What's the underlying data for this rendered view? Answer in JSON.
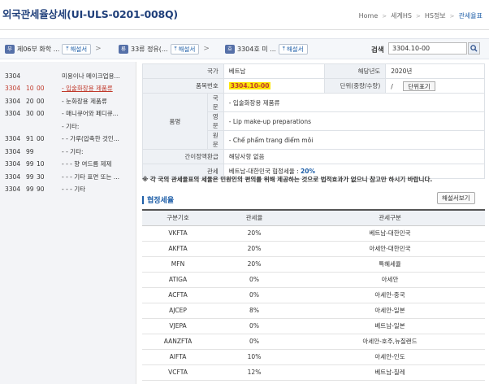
{
  "header": {
    "title": "외국관세율상세(UI-ULS-0201-008Q)",
    "breadcrumbs": [
      "Home",
      "세계HS",
      "HS정보",
      "관세율표"
    ]
  },
  "nav": {
    "segments": [
      {
        "tag": "부",
        "text": "제06부 화학 ...",
        "button": "해설서"
      },
      {
        "tag": "류",
        "text": "33류 정유(...",
        "button": "해설서"
      },
      {
        "tag": "호",
        "text": "3304호 미 ...",
        "button": "해설서"
      }
    ],
    "search_label": "검색",
    "search_value": "3304.10-00"
  },
  "tree": [
    {
      "c1": "3304",
      "c2": "",
      "c3": "",
      "desc": "미용이나 메이크업용...",
      "active": false
    },
    {
      "c1": "3304",
      "c2": "10",
      "c3": "00",
      "desc": "- 입술화장용 제품류",
      "active": true
    },
    {
      "c1": "3304",
      "c2": "20",
      "c3": "00",
      "desc": "- 눈화장용 제품류",
      "active": false
    },
    {
      "c1": "3304",
      "c2": "30",
      "c3": "00",
      "desc": "- 매니큐어와 페디큐...",
      "active": false
    },
    {
      "c1": "",
      "c2": "",
      "c3": "",
      "desc": "- 기타:",
      "active": false
    },
    {
      "c1": "3304",
      "c2": "91",
      "c3": "00",
      "desc": "- - 가루(압축한 것인...",
      "active": false
    },
    {
      "c1": "3304",
      "c2": "99",
      "c3": "",
      "desc": "- - 기타:",
      "active": false
    },
    {
      "c1": "3304",
      "c2": "99",
      "c3": "10",
      "desc": "- - - 향 여드름 제제",
      "active": false
    },
    {
      "c1": "3304",
      "c2": "99",
      "c3": "30",
      "desc": "- - - 기타 표면 또는 ...",
      "active": false
    },
    {
      "c1": "3304",
      "c2": "99",
      "c3": "90",
      "desc": "- - - 기타",
      "active": false
    }
  ],
  "info": {
    "country_label": "국가",
    "country": "베트남",
    "year_label": "해당년도",
    "year": "2020년",
    "code_label": "품목번호",
    "code": "3304.10-00",
    "unit_label": "단위(중량/수량)",
    "unit_value": "/",
    "unit_button": "단위표기",
    "item_label": "품명",
    "korean_label": "국문",
    "korean": "- 입술화장용 제품류",
    "english_label": "영문",
    "english": "- Lip make-up preparations",
    "original_label": "원문",
    "original": "- Chế phẩm trang điểm môi",
    "refund_label": "간이정액환급",
    "refund": "해당사항 없음",
    "tariff_label": "관세",
    "tariff_text": "베트남-대한민국 협정세율 : ",
    "tariff_rate": "20%"
  },
  "notice": "※ 각 국의 관세율표의 세율은 민원인의 편의를 위해 제공하는 것으로 법적효과가 없으니 참고만 하시기 바랍니다.",
  "agreement": {
    "title": "협정세율",
    "explain_button": "해설서보기",
    "columns": [
      "구분기호",
      "관세율",
      "관세구분"
    ],
    "rows": [
      [
        "VKFTA",
        "20%",
        "베트남-대한민국"
      ],
      [
        "AKFTA",
        "20%",
        "아세안-대한민국"
      ],
      [
        "MFN",
        "20%",
        "특혜세율"
      ],
      [
        "ATIGA",
        "0%",
        "아세안"
      ],
      [
        "ACFTA",
        "0%",
        "아세안-중국"
      ],
      [
        "AJCEP",
        "8%",
        "아세안-일본"
      ],
      [
        "VJEPA",
        "0%",
        "베트남-일본"
      ],
      [
        "AANZFTA",
        "0%",
        "아세안-호주,뉴질랜드"
      ],
      [
        "AIFTA",
        "10%",
        "아세안-인도"
      ],
      [
        "VCFTA",
        "12%",
        "베트남-칠레"
      ]
    ]
  },
  "colors": {
    "accent": "#1f5fa8",
    "highlight": "#fde60a",
    "active_text": "#c0392b"
  }
}
